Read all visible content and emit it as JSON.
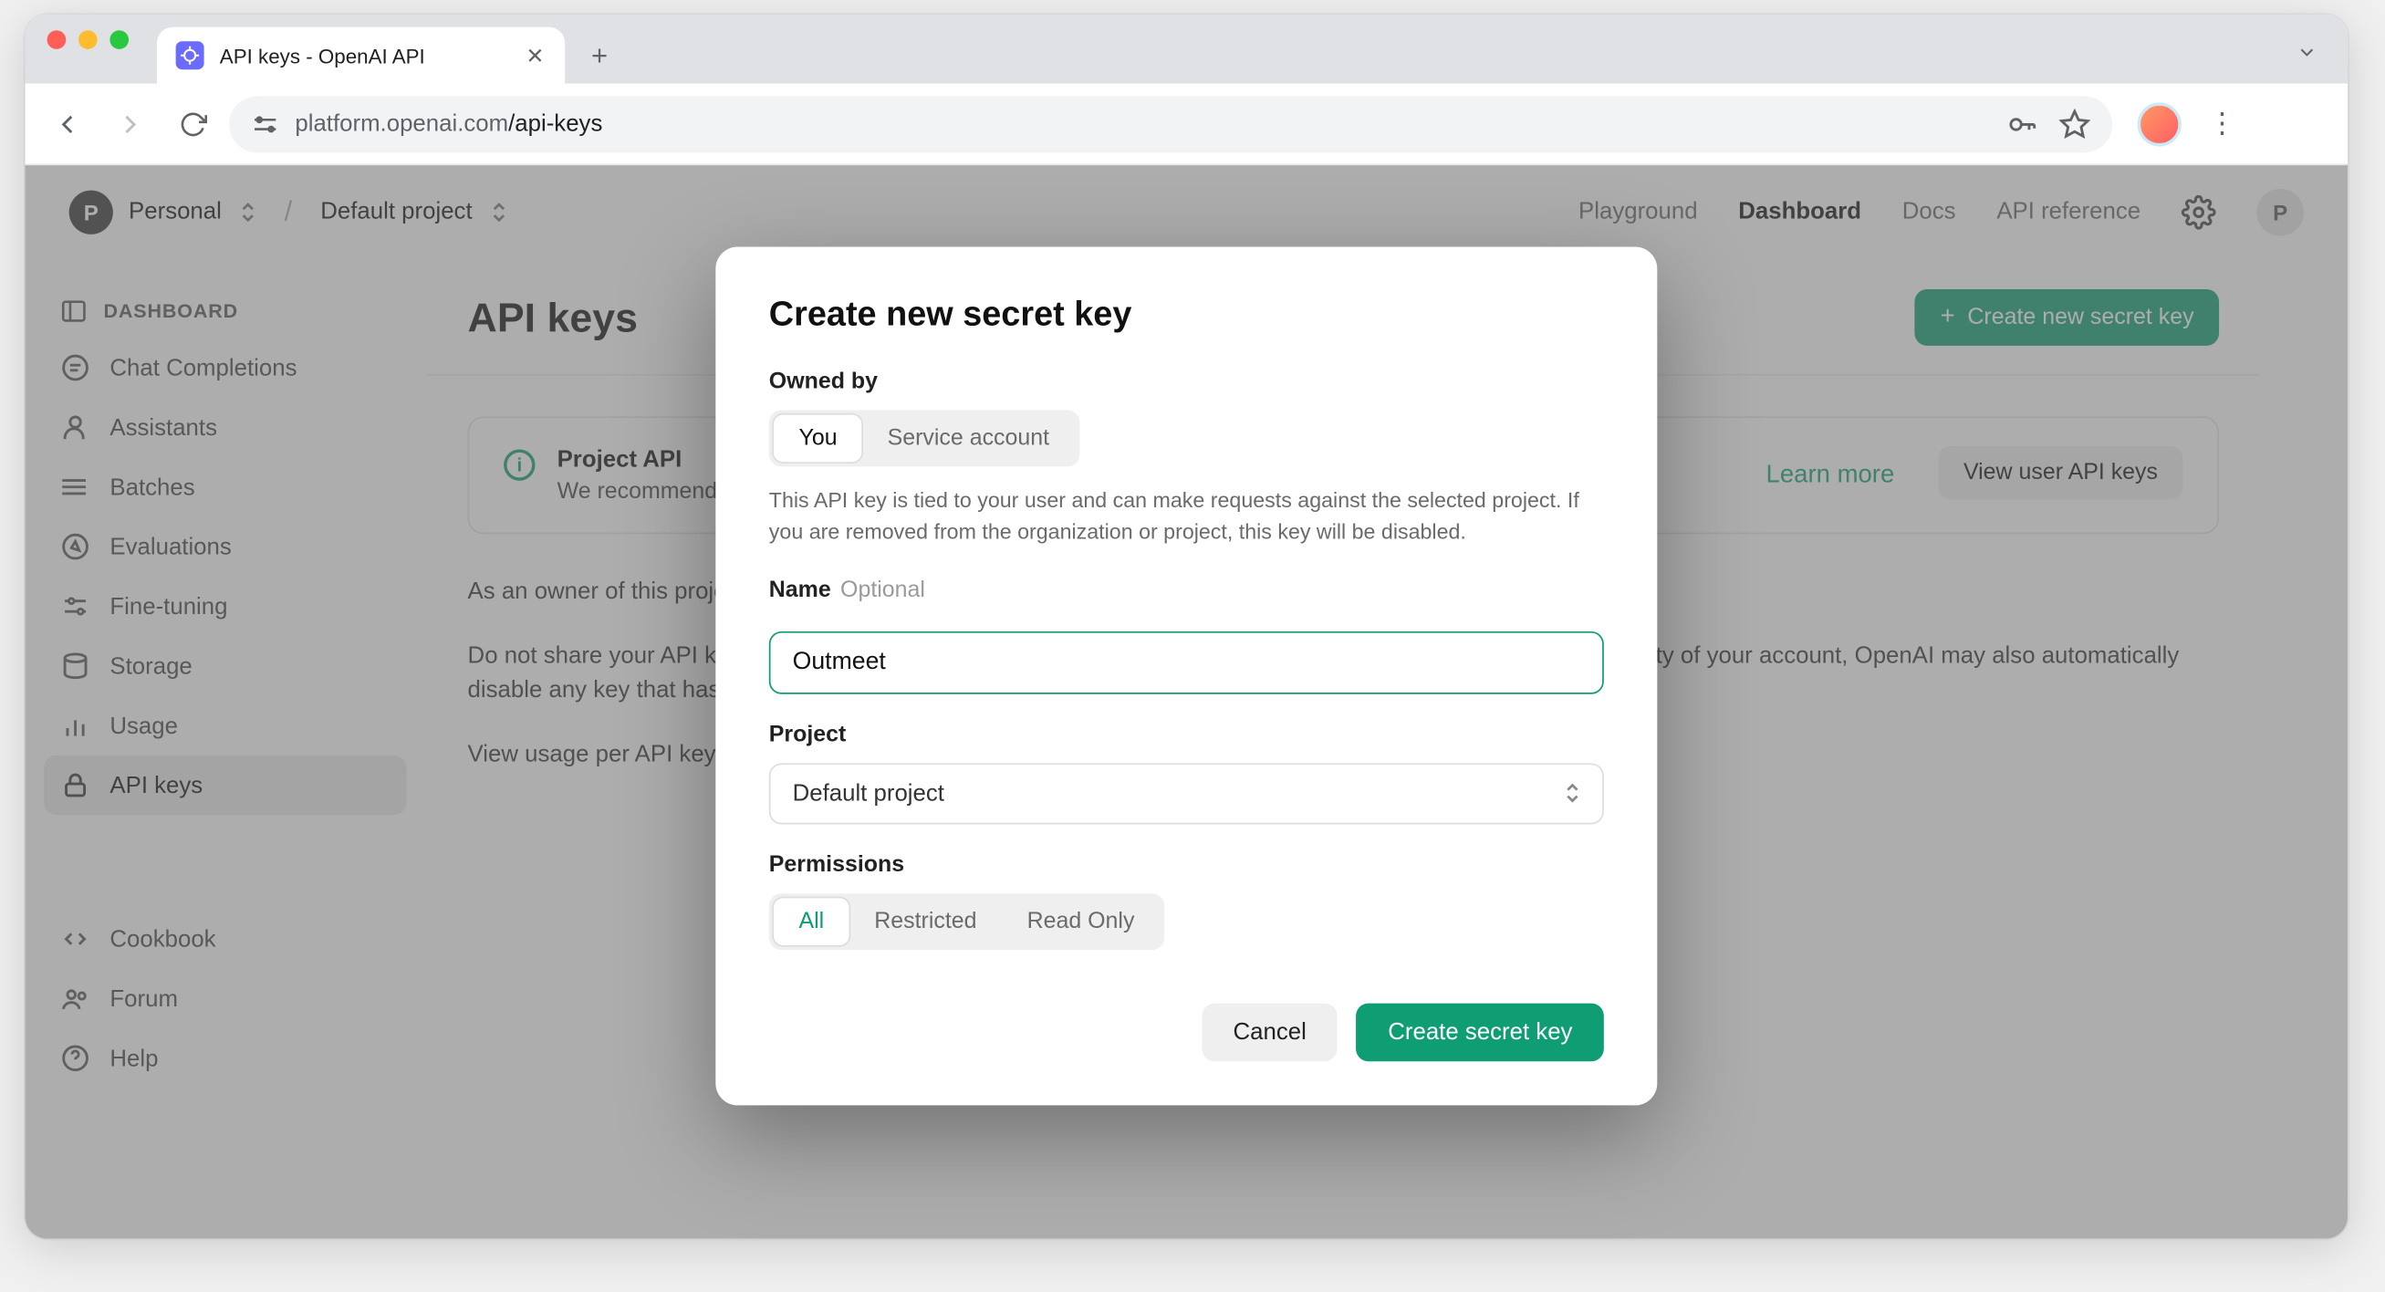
{
  "browser": {
    "tab_title": "API keys - OpenAI API",
    "url_display_dim": "platform.openai.com",
    "url_display_path": "/api-keys"
  },
  "workspace": {
    "badge": "P",
    "name": "Personal",
    "project": "Default project"
  },
  "top_nav": {
    "playground": "Playground",
    "dashboard": "Dashboard",
    "docs": "Docs",
    "api_ref": "API reference",
    "user_badge": "P"
  },
  "sidebar": {
    "heading": "DASHBOARD",
    "items": [
      {
        "label": "Chat Completions"
      },
      {
        "label": "Assistants"
      },
      {
        "label": "Batches"
      },
      {
        "label": "Evaluations"
      },
      {
        "label": "Fine-tuning"
      },
      {
        "label": "Storage"
      },
      {
        "label": "Usage"
      },
      {
        "label": "API keys"
      }
    ],
    "footer": [
      {
        "label": "Cookbook"
      },
      {
        "label": "Forum"
      },
      {
        "label": "Help"
      }
    ]
  },
  "page": {
    "title": "API keys",
    "create_btn": "Create new secret key",
    "notice_title": "Project API",
    "notice_text_prefix": "We recommend",
    "learn_more": "Learn more",
    "view_user_keys": "View user API keys",
    "para1_a": "As an owner of this project…",
    "para2": "Do not share your API key with others, or expose it in the browser or client-side code. In order to protect the security of your account, OpenAI may also automatically disable any key that has been leaked publicly.",
    "para3": "View usage per API key…"
  },
  "modal": {
    "title": "Create new secret key",
    "owned_by_label": "Owned by",
    "owned_by_options": {
      "you": "You",
      "service": "Service account"
    },
    "owned_by_help": "This API key is tied to your user and can make requests against the selected project. If you are removed from the organization or project, this key will be disabled.",
    "name_label": "Name",
    "name_optional": "Optional",
    "name_value": "Outmeet",
    "project_label": "Project",
    "project_selected": "Default project",
    "permissions_label": "Permissions",
    "permissions_options": {
      "all": "All",
      "restricted": "Restricted",
      "readonly": "Read Only"
    },
    "cancel": "Cancel",
    "submit": "Create secret key"
  }
}
